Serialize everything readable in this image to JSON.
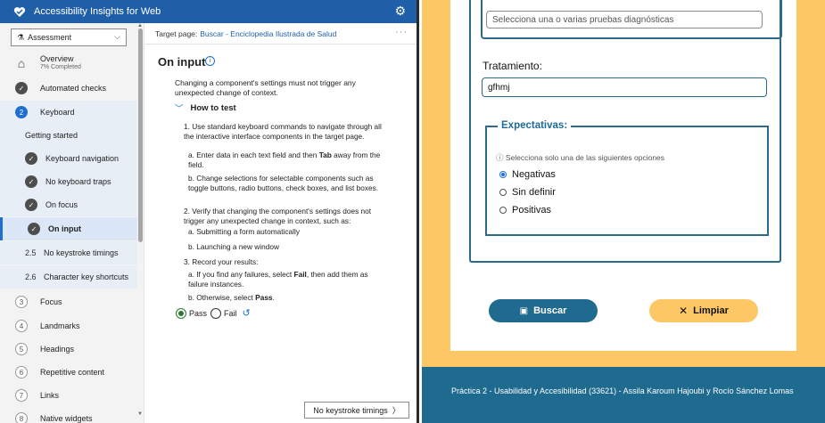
{
  "app": {
    "title": "Accessibility Insights for Web",
    "icons": {
      "logo": "heart-logo-icon",
      "settings": "gear-icon"
    }
  },
  "nav": {
    "selector": "Assessment",
    "items": [
      {
        "label": "Overview",
        "sublabel": "7% Completed",
        "icon": "home-icon"
      },
      {
        "label": "Automated checks",
        "icon": "check-circle-icon"
      },
      {
        "label": "Keyboard",
        "number": "2"
      },
      {
        "label": "Getting started"
      },
      {
        "label": "Keyboard navigation",
        "icon": "check-circle-icon"
      },
      {
        "label": "No keyboard traps",
        "icon": "check-circle-icon"
      },
      {
        "label": "On focus",
        "icon": "check-circle-icon"
      },
      {
        "label": "On input",
        "icon": "check-circle-icon"
      },
      {
        "label": "No keystroke timings",
        "number": "2.5"
      },
      {
        "label": "Character key shortcuts",
        "number": "2.6"
      },
      {
        "label": "Focus",
        "number": "3"
      },
      {
        "label": "Landmarks",
        "number": "4"
      },
      {
        "label": "Headings",
        "number": "5"
      },
      {
        "label": "Repetitive content",
        "number": "6"
      },
      {
        "label": "Links",
        "number": "7"
      },
      {
        "label": "Native widgets",
        "number": "8"
      }
    ]
  },
  "content": {
    "target_label": "Target page:",
    "target_link": "Buscar - Enciclopedia Ilustrada de Salud",
    "title": "On input",
    "description": "Changing a component's settings must not trigger any unexpected change of context.",
    "howto_label": "How to test",
    "steps": {
      "s1": "1. Use standard keyboard commands to navigate through all the interactive interface components in the target page.",
      "s1a_pre": "a. Enter data in each text field and then ",
      "s1a_bold": "Tab",
      "s1a_post": " away from the field.",
      "s1b": "b. Change selections for selectable components such as toggle buttons, radio buttons, check boxes, and list boxes.",
      "s2": "2. Verify that changing the component's settings does not trigger any unexpected change in context, such as:",
      "s2a": "a. Submitting a form automatically",
      "s2b": "b. Launching a new window",
      "s3": "3. Record your results:",
      "s3a_pre": "a. If you find any failures, select ",
      "s3a_bold": "Fail",
      "s3a_post": ", then add them as failure instances.",
      "s3b_pre": "b. Otherwise, select ",
      "s3b_bold": "Pass",
      "s3b_post": "."
    },
    "pass_label": "Pass",
    "fail_label": "Fail",
    "next_button": "No keystroke timings"
  },
  "site": {
    "diagnosticas_placeholder": "Selecciona una o varias pruebas diagnósticas",
    "tratamiento_label": "Tratamiento:",
    "tratamiento_value": "gfhmj",
    "expectativas_legend": "Expectativas:",
    "expectativas_help": "Selecciona solo una de las siguientes opciones",
    "options": [
      "Negativas",
      "Sin definir",
      "Positivas"
    ],
    "selected_option": "Negativas",
    "buscar_label": "Buscar",
    "limpiar_label": "Limpiar",
    "footer": "Práctica 2 - Usabilidad y Accesibilidad (33621) - Assila Karoum Hajoubi y Rocío Sánchez Lomas",
    "colors": {
      "brand": "#1f6a8f",
      "accent": "#fec766"
    }
  }
}
